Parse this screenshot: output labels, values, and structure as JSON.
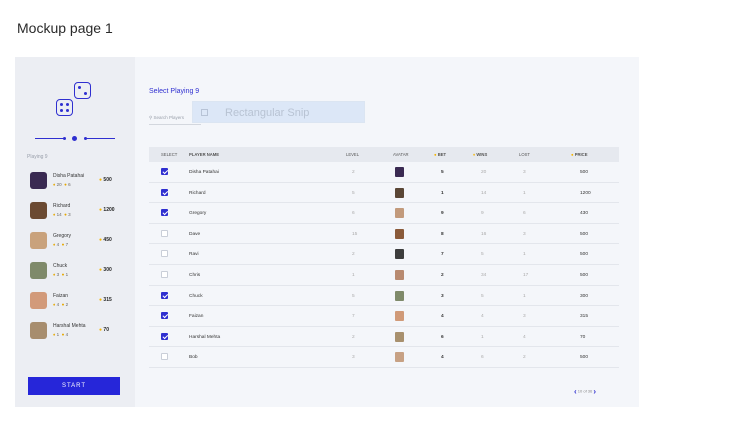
{
  "page_heading": "Mockup page 1",
  "sidebar": {
    "playing_label": "Playing 9",
    "start_label": "START",
    "players": [
      {
        "name": "Disha Patahai",
        "trophies": "20",
        "coins": "6",
        "price": "500",
        "avatar_color": "#3a2a52"
      },
      {
        "name": "Richard",
        "trophies": "14",
        "coins": "3",
        "price": "1200",
        "avatar_color": "#6b4a32"
      },
      {
        "name": "Gregory",
        "trophies": "4",
        "coins": "7",
        "price": "450",
        "avatar_color": "#c9a27c"
      },
      {
        "name": "Chuck",
        "trophies": "3",
        "coins": "1",
        "price": "300",
        "avatar_color": "#7f8a6a"
      },
      {
        "name": "Faizan",
        "trophies": "4",
        "coins": "2",
        "price": "315",
        "avatar_color": "#d29a7a"
      },
      {
        "name": "Harshal Mehta",
        "trophies": "1",
        "coins": "4",
        "price": "70",
        "avatar_color": "#a78d6e"
      }
    ]
  },
  "main": {
    "title": "Select Playing 9",
    "search_placeholder": "Search Players",
    "snip_label": "Rectangular Snip",
    "columns": {
      "select": "SELECT",
      "name": "PLAYER NAME",
      "level": "LEVEL",
      "avatar": "AVATAR",
      "bet": "BET",
      "wins": "WINS",
      "lost": "LOST",
      "price": "PRICE"
    },
    "rows": [
      {
        "checked": true,
        "name": "Disha Patahai",
        "level": "2",
        "bet": "5",
        "wins": "20",
        "lost": "3",
        "price": "500",
        "avatar_color": "#3a2a52"
      },
      {
        "checked": true,
        "name": "Richard",
        "level": "5",
        "bet": "1",
        "wins": "14",
        "lost": "1",
        "price": "1200",
        "avatar_color": "#5a4636"
      },
      {
        "checked": true,
        "name": "Gregory",
        "level": "6",
        "bet": "9",
        "wins": "9",
        "lost": "6",
        "price": "430",
        "avatar_color": "#c29a7c"
      },
      {
        "checked": false,
        "name": "Dave",
        "level": "15",
        "bet": "8",
        "wins": "16",
        "lost": "3",
        "price": "500",
        "avatar_color": "#8a5a3a"
      },
      {
        "checked": false,
        "name": "Ravi",
        "level": "2",
        "bet": "7",
        "wins": "5",
        "lost": "1",
        "price": "500",
        "avatar_color": "#3d3d3d"
      },
      {
        "checked": false,
        "name": "Chris",
        "level": "1",
        "bet": "2",
        "wins": "34",
        "lost": "17",
        "price": "500",
        "avatar_color": "#b88a70"
      },
      {
        "checked": true,
        "name": "Chuck",
        "level": "5",
        "bet": "3",
        "wins": "5",
        "lost": "1",
        "price": "300",
        "avatar_color": "#7f8a6a"
      },
      {
        "checked": true,
        "name": "Faizan",
        "level": "7",
        "bet": "4",
        "wins": "4",
        "lost": "3",
        "price": "315",
        "avatar_color": "#d09a78"
      },
      {
        "checked": true,
        "name": "Harshal Mehta",
        "level": "2",
        "bet": "6",
        "wins": "1",
        "lost": "4",
        "price": "70",
        "avatar_color": "#a8906e"
      },
      {
        "checked": false,
        "name": "Bob",
        "level": "3",
        "bet": "4",
        "wins": "6",
        "lost": "2",
        "price": "500",
        "avatar_color": "#c7a184"
      }
    ],
    "pagination": "10 of 36"
  },
  "colors": {
    "accent": "#2f2fd0",
    "coin": "#f5b400",
    "start_button": "#2626d9"
  }
}
